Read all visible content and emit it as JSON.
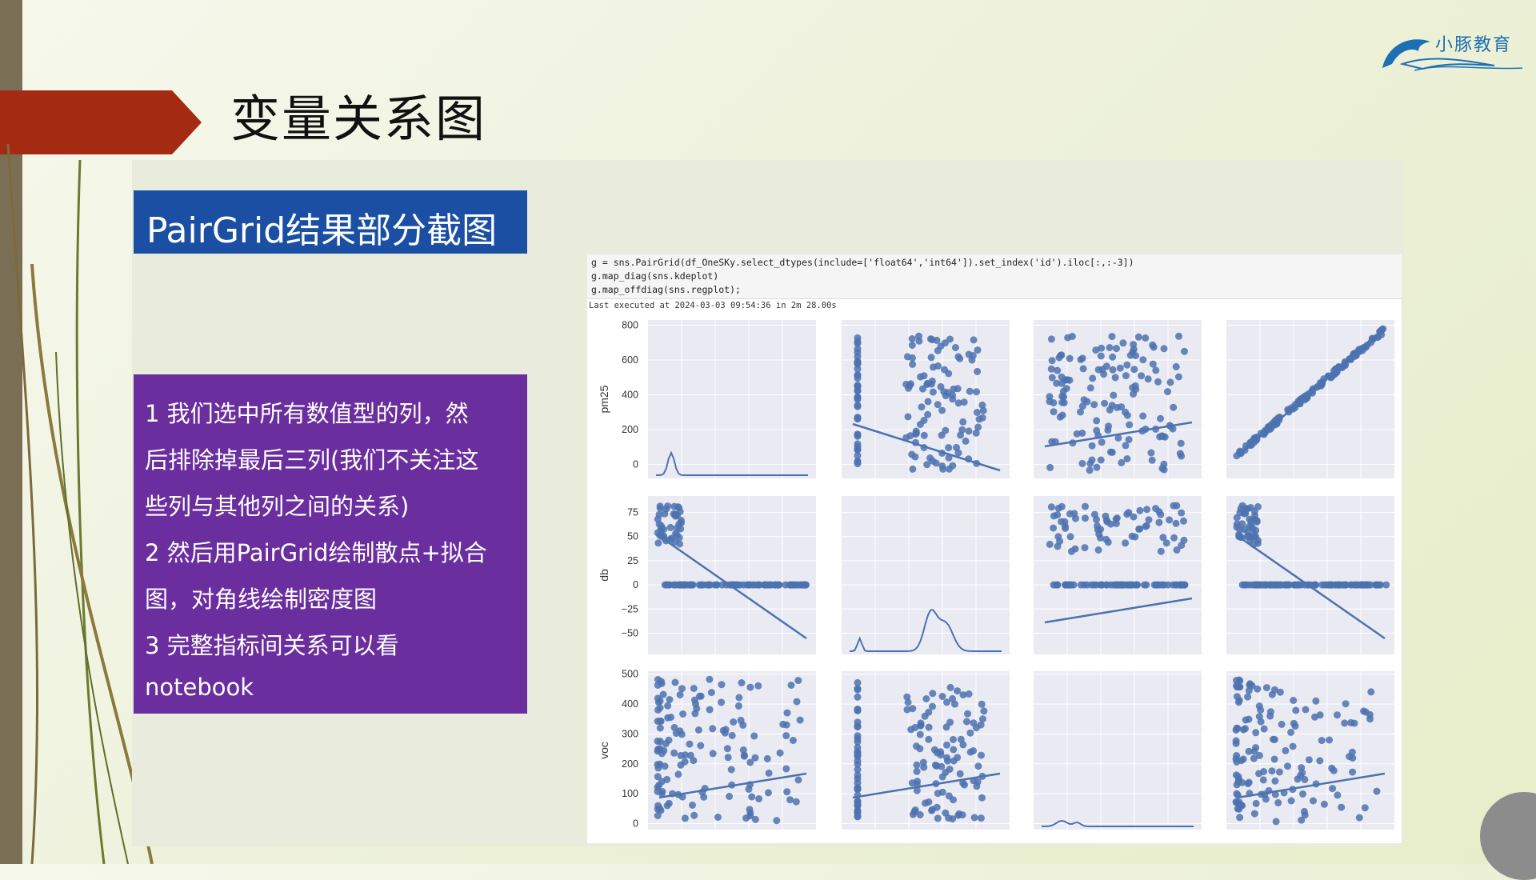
{
  "slide": {
    "title": "变量关系图",
    "logo_text": "小豚教育",
    "section_label": "PairGrid结果部分截图",
    "notes": [
      "1 我们选中所有数值型的列，然",
      "后排除掉最后三列(我们不关注这",
      "些列与其他列之间的关系)",
      "2 然后用PairGrid绘制散点+拟合",
      "图，对角线绘制密度图",
      "3 完整指标间关系可以看",
      "notebook"
    ]
  },
  "notebook": {
    "code_lines": [
      "g = sns.PairGrid(df_OneSKy.select_dtypes(include=['float64','int64']).set_index('id').iloc[:,:-3])",
      "g.map_diag(sns.kdeplot)",
      "g.map_offdiag(sns.regplot);"
    ],
    "exec_status": "Last executed at 2024-03-03 09:54:36 in 2m 28.00s"
  },
  "colors": {
    "red_arrow": "#a52a12",
    "blue_box": "#1b4fa3",
    "purple_box": "#6a2e9e",
    "marker": "#4c72b0",
    "facet_bg": "#eaeaf2"
  },
  "chart_data": {
    "type": "scatter",
    "variables": [
      "pm25",
      "db",
      "voc"
    ],
    "row_labels": [
      "pm25",
      "db",
      "voc"
    ],
    "diag": "kde",
    "offdiag": "scatter+regression",
    "rows": [
      {
        "name": "pm25",
        "ticks": [
          "800",
          "600",
          "400",
          "200",
          "0"
        ],
        "tick_values": [
          800,
          600,
          400,
          200,
          0
        ],
        "ylim": [
          -80,
          830
        ]
      },
      {
        "name": "db",
        "ticks": [
          "75",
          "50",
          "25",
          "0",
          "−25",
          "−50"
        ],
        "tick_values": [
          75,
          50,
          25,
          0,
          -25,
          -50
        ],
        "ylim": [
          -72,
          92
        ]
      },
      {
        "name": "voc",
        "ticks": [
          "500",
          "400",
          "300",
          "200",
          "100",
          "0"
        ],
        "tick_values": [
          500,
          400,
          300,
          200,
          100,
          0
        ],
        "ylim": [
          -20,
          510
        ]
      }
    ]
  }
}
